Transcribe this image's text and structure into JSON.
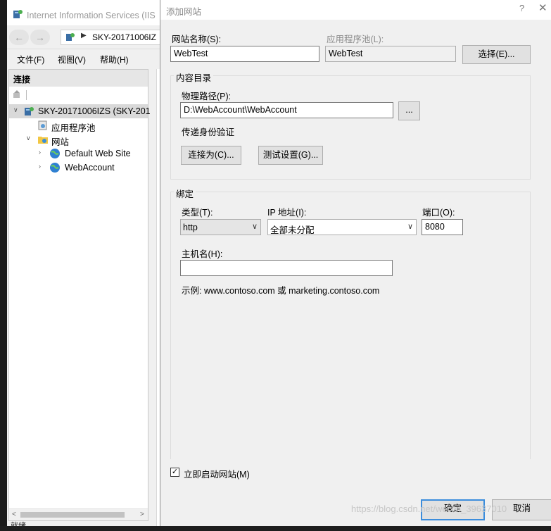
{
  "iis": {
    "title": "Internet Information Services (IIS",
    "address": "SKY-20171006IZ",
    "menu": [
      "文件(F)",
      "视图(V)",
      "帮助(H)"
    ],
    "connections_header": "连接",
    "tree": [
      {
        "label": "SKY-20171006IZS (SKY-201",
        "icon": "server-icon"
      },
      {
        "label": "应用程序池",
        "icon": "app-pool-icon"
      },
      {
        "label": "网站",
        "icon": "sites-folder-icon"
      },
      {
        "label": "Default Web Site",
        "icon": "globe-icon"
      },
      {
        "label": "WebAccount",
        "icon": "globe-icon"
      }
    ],
    "status": "就绪"
  },
  "dialog": {
    "title": "添加网站",
    "help": "?",
    "close": "✕",
    "site_name_label": "网站名称(S):",
    "site_name_value": "WebTest",
    "app_pool_label": "应用程序池(L):",
    "app_pool_value": "WebTest",
    "select_button": "选择(E)...",
    "content_dir_caption": "内容目录",
    "physical_path_label": "物理路径(P):",
    "physical_path_value": "D:\\WebAccount\\WebAccount",
    "browse_button": "...",
    "pass_through_label": "传递身份验证",
    "connect_as_button": "连接为(C)...",
    "test_settings_button": "测试设置(G)...",
    "binding_caption": "绑定",
    "type_label": "类型(T):",
    "type_value": "http",
    "ip_label": "IP 地址(I):",
    "ip_value": "全部未分配",
    "port_label": "端口(O):",
    "port_value": "8080",
    "host_label": "主机名(H):",
    "host_value": "",
    "example_text": "示例: www.contoso.com 或 marketing.contoso.com",
    "start_immediately_label": "立即启动网站(M)",
    "start_immediately_checked": true,
    "ok_button": "确定",
    "cancel_button": "取消"
  },
  "watermark": "https://blog.csdn.net/weixin_39637010"
}
